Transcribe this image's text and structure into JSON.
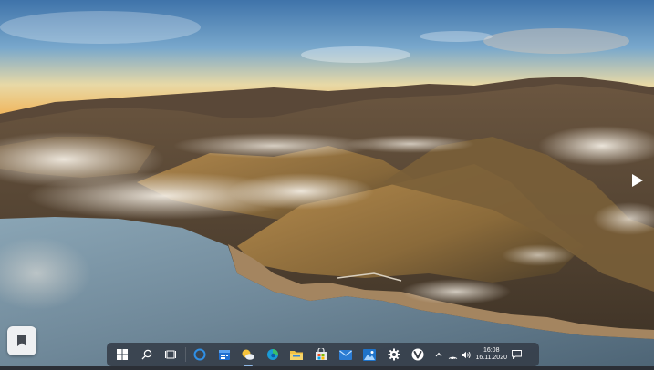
{
  "desktop": {
    "wallpaper": "mountain-coast-landscape",
    "next_icon": "chevron-right-icon",
    "bookmark_icon": "bookmark-icon"
  },
  "taskbar": {
    "pinned": [
      {
        "name": "start-button",
        "icon": "windows-logo-icon"
      },
      {
        "name": "search-button",
        "icon": "search-icon"
      },
      {
        "name": "task-view-button",
        "icon": "task-view-icon"
      },
      {
        "name": "cortana-button",
        "icon": "circle-icon"
      },
      {
        "name": "calendar-app",
        "icon": "calendar-icon"
      },
      {
        "name": "weather-app",
        "icon": "sun-cloud-icon",
        "active": true
      },
      {
        "name": "edge-browser",
        "icon": "edge-icon"
      },
      {
        "name": "file-explorer",
        "icon": "folder-icon"
      },
      {
        "name": "microsoft-store",
        "icon": "store-bag-icon"
      },
      {
        "name": "mail-app",
        "icon": "mail-icon"
      },
      {
        "name": "photos-app",
        "icon": "photos-icon"
      },
      {
        "name": "settings-app",
        "icon": "gear-icon"
      },
      {
        "name": "vivaldi-browser",
        "icon": "v-logo-icon"
      }
    ],
    "tray": [
      "chevron-up-icon",
      "network-icon",
      "volume-icon"
    ],
    "clock": {
      "time": "16:08",
      "date": "16.11.2020"
    },
    "notification_icon": "notification-icon"
  }
}
